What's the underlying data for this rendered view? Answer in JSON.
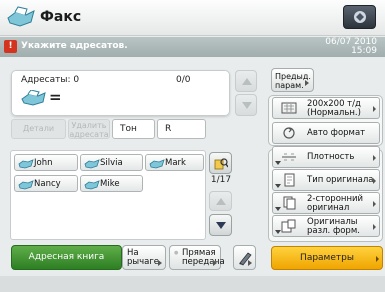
{
  "title_bar": {
    "title": "Факс",
    "status_icon": "status-monitor-icon"
  },
  "message_bar": {
    "message": "Укажите адресатов.",
    "date": "06/07 2010",
    "time": "15:09"
  },
  "address_display": {
    "label": "Адресаты: 0",
    "count": "0/0",
    "equals": "="
  },
  "address_actions": {
    "details": "Детали",
    "delete_line1": "Удалить",
    "delete_line2": "адресата",
    "tone": "Тон",
    "r": "R"
  },
  "contacts": [
    "John",
    "Silvia",
    "Mark",
    "Nancy",
    "Mike"
  ],
  "page_indicator": "1/17",
  "bottom_left": {
    "address_book": "Адресная книга",
    "on_hook_line1": "На",
    "on_hook_line2": "рычаге",
    "direct_line1": "Прямая",
    "direct_line2": "передача"
  },
  "right_panel": {
    "preview_line1": "Предыд.",
    "preview_line2": "парам.",
    "resolution_line1": "200x200 т/д",
    "resolution_line2": "(Нормальн.)",
    "auto_format": "Авто формат",
    "density": "Плотность",
    "original_type": "Тип оригинала",
    "two_sided_line1": "2-сторонний",
    "two_sided_line2": "оригинал",
    "different_sizes_line1": "Оригиналы",
    "different_sizes_line2": "разл. форм.",
    "parameters": "Параметры"
  },
  "colors": {
    "address_book_green": "#2d7f23",
    "params_yellow": "#f5b400",
    "warning_red": "#d4341e"
  }
}
